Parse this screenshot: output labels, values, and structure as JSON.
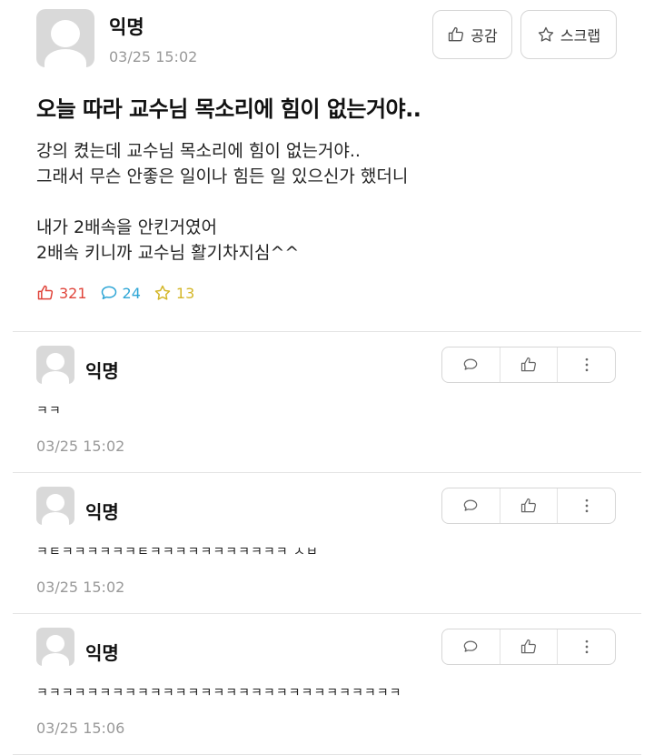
{
  "post": {
    "author": "익명",
    "time": "03/25 15:02",
    "empathy_button": {
      "label": "공감",
      "icon": "thumbs-up-icon"
    },
    "scrap_button": {
      "label": "스크랩",
      "icon": "star-icon"
    },
    "title": "오늘 따라 교수님 목소리에 힘이 없는거야..",
    "body": "강의 켰는데 교수님 목소리에 힘이 없는거야..\n그래서 무슨 안좋은 일이나 힘든 일 있으신가 했더니\n\n내가 2배속을 안킨거였어\n2배속 키니까 교수님 활기차지심^^",
    "stats": {
      "likes": "321",
      "comments": "24",
      "scraps": "13",
      "like_color": "#e0443a",
      "comment_color": "#2ea6d6",
      "scrap_color": "#d4b72a"
    }
  },
  "comments": [
    {
      "author": "익명",
      "text": "ㅋㅋ",
      "time": "03/25 15:02"
    },
    {
      "author": "익명",
      "text": "ㅋㅌㅋㅋㅋㅋㅋㅋㅌㅋㅋㅋㅋㅋㅋㅋㅋㅋㅋㅋ ㅅㅂ",
      "time": "03/25 15:02"
    },
    {
      "author": "익명",
      "text": "ㅋㅋㅋㅋㅋㅋㅋㅋㅋㅋㅋㅋㅋㅋㅋㅋㅋㅋㅋㅋㅋㅋㅋㅋㅋㅋㅋㅋㅋ",
      "time": "03/25 15:06"
    }
  ],
  "comment_actions": [
    "speech-bubble-icon",
    "thumbs-up-icon",
    "more-vertical-icon"
  ]
}
